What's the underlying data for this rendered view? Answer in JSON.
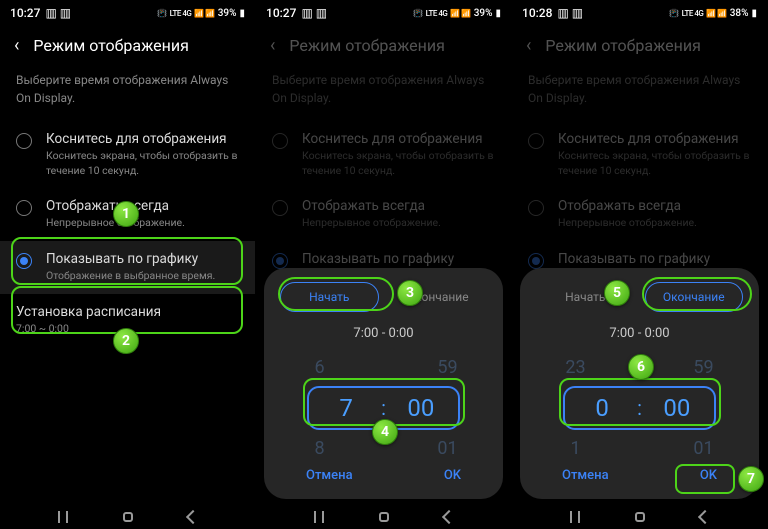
{
  "screen1": {
    "time": "10:27",
    "battery": "39%",
    "net": "LTE 4G",
    "title": "Режим отображения",
    "desc": "Выберите время отображения Always On Display.",
    "opt1_t": "Коснитесь для отображения",
    "opt1_s": "Коснитесь экрана, чтобы отобразить в течение 10 секунд.",
    "opt2_t": "Отображать всегда",
    "opt2_s": "Непрерывное отображение.",
    "opt3_t": "Показывать по графику",
    "opt3_s": "Отображение в выбранное время.",
    "sched_t": "Установка расписания",
    "sched_v": "7:00 ~ 0:00"
  },
  "screen2": {
    "time": "10:27",
    "battery": "39%",
    "seg_start": "Начать",
    "seg_end": "Окончание",
    "range": "7:00   -   0:00",
    "prev_h": "6",
    "prev_m": "59",
    "cur_h": "7",
    "cur_m": "00",
    "next_h": "8",
    "next_m": "01",
    "cancel": "Отмена",
    "ok": "OK"
  },
  "screen3": {
    "time": "10:28",
    "battery": "38%",
    "seg_start": "Начать",
    "seg_end": "Окончание",
    "range": "7:00   -   0:00",
    "prev_h": "23",
    "prev_m": "59",
    "cur_h": "0",
    "cur_m": "00",
    "next_h": "1",
    "next_m": "01",
    "cancel": "Отмена",
    "ok": "OK"
  },
  "badges": {
    "b1": "1",
    "b2": "2",
    "b3": "3",
    "b4": "4",
    "b5": "5",
    "b6": "6",
    "b7": "7"
  }
}
